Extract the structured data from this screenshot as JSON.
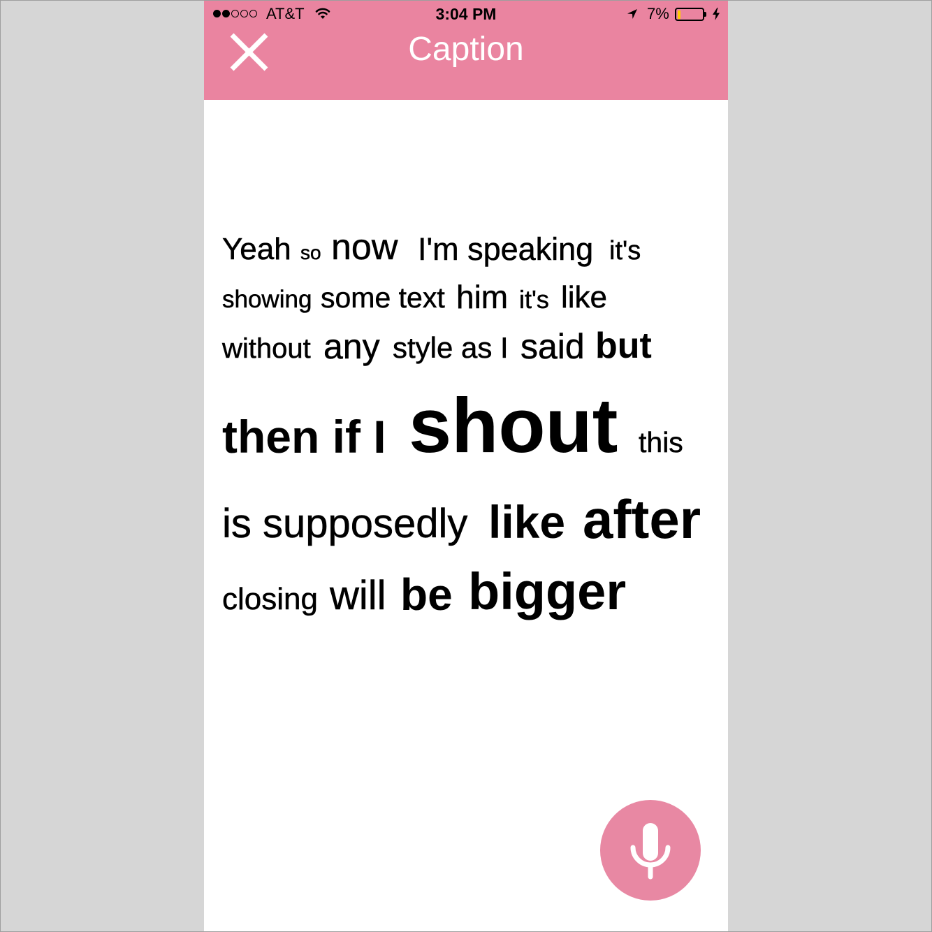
{
  "status_bar": {
    "carrier": "AT&T",
    "signal_strength": 2,
    "signal_max": 5,
    "time": "3:04 PM",
    "battery_text": "7%",
    "battery_level": 0.07,
    "icons": [
      "signal-dots-icon",
      "wifi-icon",
      "location-arrow-icon",
      "battery-icon",
      "charging-bolt-icon"
    ]
  },
  "header": {
    "title": "Caption",
    "close_icon": "close-icon"
  },
  "caption": {
    "lines": [
      [
        "Yeah",
        "so",
        "now",
        "I'm speaking",
        "it's"
      ],
      [
        "showing",
        "some text",
        "him",
        "it's",
        "like"
      ],
      [
        "without",
        "any",
        "style as I",
        "said",
        "but"
      ],
      [
        "then if I",
        "shout",
        "this"
      ],
      [
        "is supposedly",
        "like",
        "after"
      ],
      [
        "closing",
        "will",
        "be",
        "bigger"
      ]
    ]
  },
  "mic_button": {
    "icon": "microphone-icon"
  },
  "colors": {
    "accent": "#EA84A0",
    "mic": "#E888A3",
    "background": "#D6D6D6",
    "text": "#000000",
    "battery_low": "#FFCC00"
  }
}
